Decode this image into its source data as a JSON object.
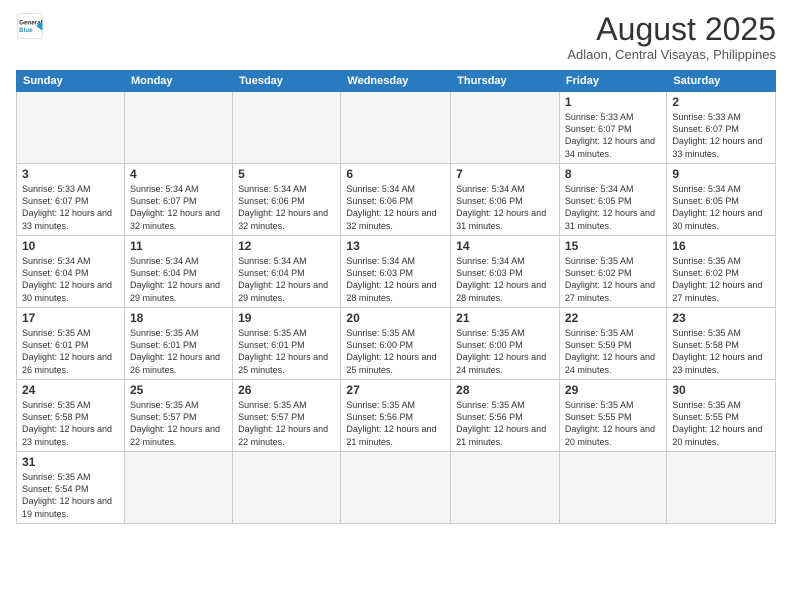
{
  "header": {
    "logo_general": "General",
    "logo_blue": "Blue",
    "month_title": "August 2025",
    "location": "Adlaon, Central Visayas, Philippines"
  },
  "days_of_week": [
    "Sunday",
    "Monday",
    "Tuesday",
    "Wednesday",
    "Thursday",
    "Friday",
    "Saturday"
  ],
  "weeks": [
    {
      "days": [
        {
          "num": "",
          "info": ""
        },
        {
          "num": "",
          "info": ""
        },
        {
          "num": "",
          "info": ""
        },
        {
          "num": "",
          "info": ""
        },
        {
          "num": "",
          "info": ""
        },
        {
          "num": "1",
          "info": "Sunrise: 5:33 AM\nSunset: 6:07 PM\nDaylight: 12 hours\nand 34 minutes."
        },
        {
          "num": "2",
          "info": "Sunrise: 5:33 AM\nSunset: 6:07 PM\nDaylight: 12 hours\nand 33 minutes."
        }
      ]
    },
    {
      "days": [
        {
          "num": "3",
          "info": "Sunrise: 5:33 AM\nSunset: 6:07 PM\nDaylight: 12 hours\nand 33 minutes."
        },
        {
          "num": "4",
          "info": "Sunrise: 5:34 AM\nSunset: 6:07 PM\nDaylight: 12 hours\nand 32 minutes."
        },
        {
          "num": "5",
          "info": "Sunrise: 5:34 AM\nSunset: 6:06 PM\nDaylight: 12 hours\nand 32 minutes."
        },
        {
          "num": "6",
          "info": "Sunrise: 5:34 AM\nSunset: 6:06 PM\nDaylight: 12 hours\nand 32 minutes."
        },
        {
          "num": "7",
          "info": "Sunrise: 5:34 AM\nSunset: 6:06 PM\nDaylight: 12 hours\nand 31 minutes."
        },
        {
          "num": "8",
          "info": "Sunrise: 5:34 AM\nSunset: 6:05 PM\nDaylight: 12 hours\nand 31 minutes."
        },
        {
          "num": "9",
          "info": "Sunrise: 5:34 AM\nSunset: 6:05 PM\nDaylight: 12 hours\nand 30 minutes."
        }
      ]
    },
    {
      "days": [
        {
          "num": "10",
          "info": "Sunrise: 5:34 AM\nSunset: 6:04 PM\nDaylight: 12 hours\nand 30 minutes."
        },
        {
          "num": "11",
          "info": "Sunrise: 5:34 AM\nSunset: 6:04 PM\nDaylight: 12 hours\nand 29 minutes."
        },
        {
          "num": "12",
          "info": "Sunrise: 5:34 AM\nSunset: 6:04 PM\nDaylight: 12 hours\nand 29 minutes."
        },
        {
          "num": "13",
          "info": "Sunrise: 5:34 AM\nSunset: 6:03 PM\nDaylight: 12 hours\nand 28 minutes."
        },
        {
          "num": "14",
          "info": "Sunrise: 5:34 AM\nSunset: 6:03 PM\nDaylight: 12 hours\nand 28 minutes."
        },
        {
          "num": "15",
          "info": "Sunrise: 5:35 AM\nSunset: 6:02 PM\nDaylight: 12 hours\nand 27 minutes."
        },
        {
          "num": "16",
          "info": "Sunrise: 5:35 AM\nSunset: 6:02 PM\nDaylight: 12 hours\nand 27 minutes."
        }
      ]
    },
    {
      "days": [
        {
          "num": "17",
          "info": "Sunrise: 5:35 AM\nSunset: 6:01 PM\nDaylight: 12 hours\nand 26 minutes."
        },
        {
          "num": "18",
          "info": "Sunrise: 5:35 AM\nSunset: 6:01 PM\nDaylight: 12 hours\nand 26 minutes."
        },
        {
          "num": "19",
          "info": "Sunrise: 5:35 AM\nSunset: 6:01 PM\nDaylight: 12 hours\nand 25 minutes."
        },
        {
          "num": "20",
          "info": "Sunrise: 5:35 AM\nSunset: 6:00 PM\nDaylight: 12 hours\nand 25 minutes."
        },
        {
          "num": "21",
          "info": "Sunrise: 5:35 AM\nSunset: 6:00 PM\nDaylight: 12 hours\nand 24 minutes."
        },
        {
          "num": "22",
          "info": "Sunrise: 5:35 AM\nSunset: 5:59 PM\nDaylight: 12 hours\nand 24 minutes."
        },
        {
          "num": "23",
          "info": "Sunrise: 5:35 AM\nSunset: 5:58 PM\nDaylight: 12 hours\nand 23 minutes."
        }
      ]
    },
    {
      "days": [
        {
          "num": "24",
          "info": "Sunrise: 5:35 AM\nSunset: 5:58 PM\nDaylight: 12 hours\nand 23 minutes."
        },
        {
          "num": "25",
          "info": "Sunrise: 5:35 AM\nSunset: 5:57 PM\nDaylight: 12 hours\nand 22 minutes."
        },
        {
          "num": "26",
          "info": "Sunrise: 5:35 AM\nSunset: 5:57 PM\nDaylight: 12 hours\nand 22 minutes."
        },
        {
          "num": "27",
          "info": "Sunrise: 5:35 AM\nSunset: 5:56 PM\nDaylight: 12 hours\nand 21 minutes."
        },
        {
          "num": "28",
          "info": "Sunrise: 5:35 AM\nSunset: 5:56 PM\nDaylight: 12 hours\nand 21 minutes."
        },
        {
          "num": "29",
          "info": "Sunrise: 5:35 AM\nSunset: 5:55 PM\nDaylight: 12 hours\nand 20 minutes."
        },
        {
          "num": "30",
          "info": "Sunrise: 5:35 AM\nSunset: 5:55 PM\nDaylight: 12 hours\nand 20 minutes."
        }
      ]
    },
    {
      "days": [
        {
          "num": "31",
          "info": "Sunrise: 5:35 AM\nSunset: 5:54 PM\nDaylight: 12 hours\nand 19 minutes."
        },
        {
          "num": "",
          "info": ""
        },
        {
          "num": "",
          "info": ""
        },
        {
          "num": "",
          "info": ""
        },
        {
          "num": "",
          "info": ""
        },
        {
          "num": "",
          "info": ""
        },
        {
          "num": "",
          "info": ""
        }
      ]
    }
  ]
}
